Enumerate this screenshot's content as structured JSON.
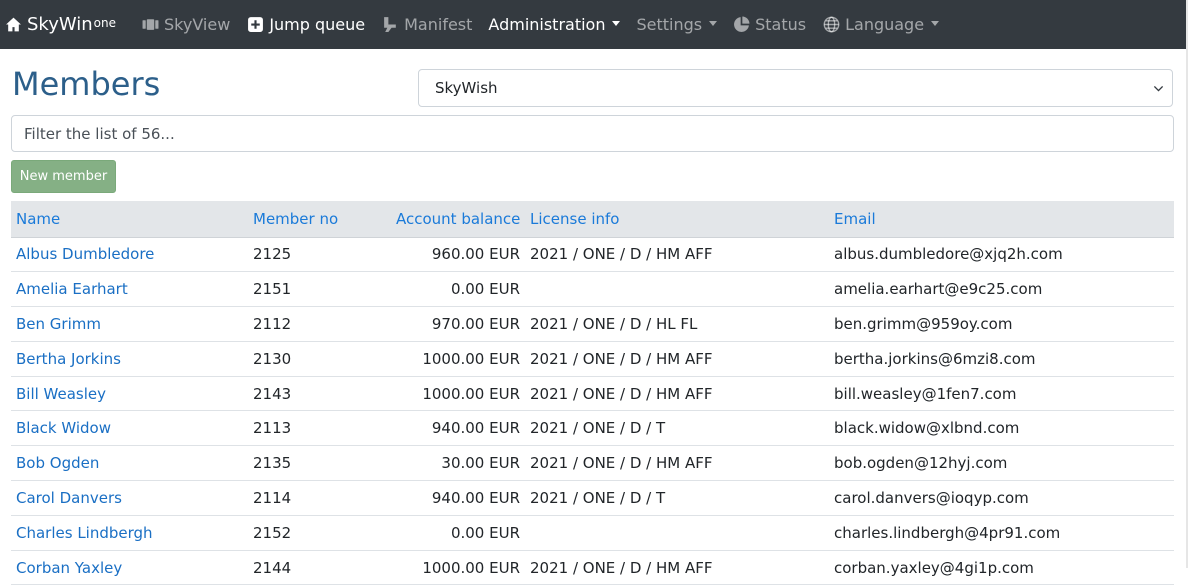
{
  "nav": {
    "brand": "SkyWin",
    "brand_sup": "one",
    "items": [
      {
        "label": "SkyView",
        "icon": "film-icon"
      },
      {
        "label": "Jump queue",
        "icon": "plus-square-icon"
      },
      {
        "label": "Manifest",
        "icon": "manifest-icon"
      },
      {
        "label": "Administration",
        "dropdown": true
      },
      {
        "label": "Settings",
        "dropdown": true
      },
      {
        "label": "Status",
        "icon": "pie-chart-icon"
      },
      {
        "label": "Language",
        "icon": "globe-icon",
        "dropdown": true
      }
    ]
  },
  "page": {
    "title": "Members",
    "club_select": "SkyWish",
    "filter_placeholder": "Filter the list of 56...",
    "new_button": "New member"
  },
  "table": {
    "headers": [
      "Name",
      "Member no",
      "Account balance",
      "License info",
      "Email"
    ],
    "rows": [
      [
        "Albus Dumbledore",
        "2125",
        "960.00 EUR",
        "2021 / ONE / D / HM AFF",
        "albus.dumbledore@xjq2h.com"
      ],
      [
        "Amelia Earhart",
        "2151",
        "0.00 EUR",
        "",
        "amelia.earhart@e9c25.com"
      ],
      [
        "Ben Grimm",
        "2112",
        "970.00 EUR",
        "2021 / ONE / D / HL FL",
        "ben.grimm@959oy.com"
      ],
      [
        "Bertha Jorkins",
        "2130",
        "1000.00 EUR",
        "2021 / ONE / D / HM AFF",
        "bertha.jorkins@6mzi8.com"
      ],
      [
        "Bill Weasley",
        "2143",
        "1000.00 EUR",
        "2021 / ONE / D / HM AFF",
        "bill.weasley@1fen7.com"
      ],
      [
        "Black Widow",
        "2113",
        "940.00 EUR",
        "2021 / ONE / D / T",
        "black.widow@xlbnd.com"
      ],
      [
        "Bob Ogden",
        "2135",
        "30.00 EUR",
        "2021 / ONE / D / HM AFF",
        "bob.ogden@12hyj.com"
      ],
      [
        "Carol Danvers",
        "2114",
        "940.00 EUR",
        "2021 / ONE / D / T",
        "carol.danvers@ioqyp.com"
      ],
      [
        "Charles Lindbergh",
        "2152",
        "0.00 EUR",
        "",
        "charles.lindbergh@4pr91.com"
      ],
      [
        "Corban Yaxley",
        "2144",
        "1000.00 EUR",
        "2021 / ONE / D / HM AFF",
        "corban.yaxley@4gi1p.com"
      ]
    ]
  }
}
